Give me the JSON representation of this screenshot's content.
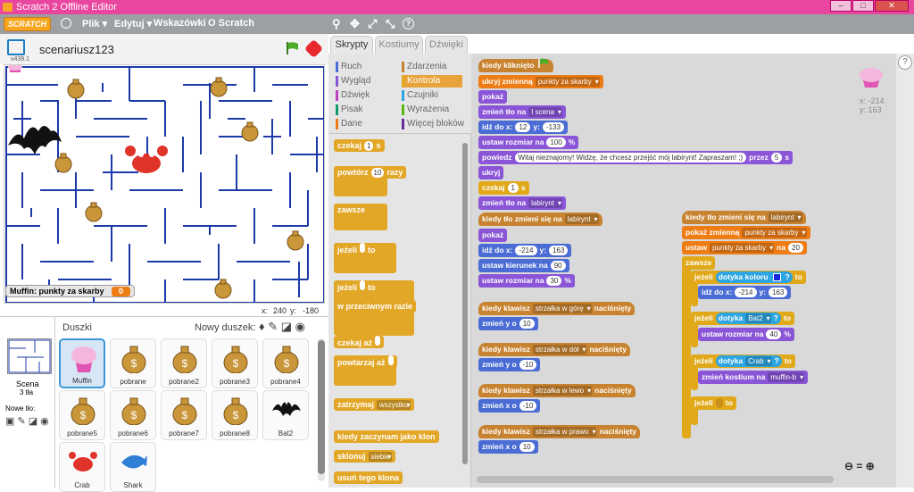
{
  "window": {
    "title": "Scratch 2 Offline Editor"
  },
  "menu": {
    "logo": "SCRATCH",
    "items": [
      "Plik ▾",
      "Edytuj ▾",
      "Wskazówki",
      "O Scratch"
    ]
  },
  "stage": {
    "project_name": "scenariusz123",
    "version": "v439.1",
    "monitor_label": "Muffin: punkty za skarby",
    "monitor_value": "0",
    "x_label": "x:",
    "x_value": "240",
    "y_label": "y:",
    "y_value": "-180"
  },
  "sprites_panel": {
    "title": "Duszki",
    "new_sprite": "Nowy duszek:",
    "scene_label": "Scena",
    "scene_count": "3 tła",
    "new_backdrop": "Nowe tło:",
    "sprites": [
      "Muffin",
      "pobrane",
      "pobrane2",
      "pobrane3",
      "pobrane4",
      "pobrane5",
      "pobrane6",
      "pobrane7",
      "pobrane8",
      "Bat2",
      "Crab",
      "Shark"
    ]
  },
  "tabs": [
    "Skrypty",
    "Kostiumy",
    "Dźwięki"
  ],
  "categories": [
    {
      "name": "Ruch",
      "color": "#4a6cd4"
    },
    {
      "name": "Zdarzenia",
      "color": "#c88330"
    },
    {
      "name": "Wygląd",
      "color": "#8a55d7"
    },
    {
      "name": "Kontrola",
      "color": "#e1a91a"
    },
    {
      "name": "Dźwięk",
      "color": "#bb42c3"
    },
    {
      "name": "Czujniki",
      "color": "#2ca5e2"
    },
    {
      "name": "Pisak",
      "color": "#0e9a6c"
    },
    {
      "name": "Wyrażenia",
      "color": "#5cb712"
    },
    {
      "name": "Dane",
      "color": "#ee7d16"
    },
    {
      "name": "Więcej bloków",
      "color": "#632d99"
    }
  ],
  "palette_blocks": [
    "czekaj",
    "s",
    "powtórz",
    "razy",
    "zawsze",
    "jeżeli",
    "to",
    "jeżeli",
    "to",
    "w przeciwnym razie",
    "czekaj aż",
    "powtarzaj aż",
    "zatrzymaj",
    "wszystko",
    "kiedy zaczynam jako klon",
    "sklonuj",
    "siebie",
    "usuń tego klona"
  ],
  "script_coords": {
    "x_label": "x:",
    "x": "-214",
    "y_label": "y:",
    "y": "163"
  },
  "scripts": {
    "main": [
      {
        "t": "kiedy kliknięto",
        "c": "ev",
        "hat": true
      },
      {
        "t": "ukryj zmienną",
        "dd": "punkty za skarby",
        "c": "data"
      },
      {
        "t": "pokaż",
        "c": "looks"
      },
      {
        "t": "zmień tło na",
        "dd": "I scena",
        "c": "looks"
      },
      {
        "t": "idź do x:",
        "i1": "12",
        "t2": "y:",
        "i2": "-133",
        "c": "motion"
      },
      {
        "t": "ustaw rozmiar na",
        "i1": "100",
        "t2": "%",
        "c": "looks"
      },
      {
        "t": "powiedz",
        "i1": "Witaj nieznajomy! Widzę, że chcesz przejść mój labirynt! Zapraszam! ;)",
        "t2": "przez",
        "i2": "5",
        "t3": "s",
        "c": "looks"
      },
      {
        "t": "ukryj",
        "c": "looks"
      },
      {
        "t": "czekaj",
        "i1": "1",
        "t2": "s",
        "c": "ctl"
      },
      {
        "t": "zmień tło na",
        "dd": "labirynt",
        "c": "looks"
      }
    ],
    "bg1": [
      {
        "t": "kiedy tło zmieni się na",
        "dd": "labirynt",
        "c": "ev",
        "hat": true
      },
      {
        "t": "pokaż",
        "c": "looks"
      },
      {
        "t": "idź do x:",
        "i1": "-214",
        "t2": "y:",
        "i2": "163",
        "c": "motion"
      },
      {
        "t": "ustaw kierunek na",
        "i1": "90",
        "c": "motion"
      },
      {
        "t": "ustaw rozmiar na",
        "i1": "30",
        "t2": "%",
        "c": "looks"
      }
    ],
    "keys": [
      {
        "key": "strzałka w górę",
        "action": "zmień y o",
        "val": "10"
      },
      {
        "key": "strzałka w dół",
        "action": "zmień y o",
        "val": "-10"
      },
      {
        "key": "strzałka w lewo",
        "action": "zmień x o",
        "val": "-10"
      },
      {
        "key": "strzałka w prawo",
        "action": "zmień x o",
        "val": "10"
      }
    ],
    "key_hat_a": "kiedy klawisz",
    "key_hat_b": "naciśnięty",
    "bg2": {
      "hat": "kiedy tło zmieni się na",
      "hat_dd": "labirynt",
      "show_var": "pokaż zmienną",
      "show_var_dd": "punkty za skarby",
      "set_var": "ustaw",
      "set_var_dd": "punkty za skarby",
      "set_to": "na",
      "set_val": "20",
      "forever": "zawsze",
      "if": "jeżeli",
      "then": "to",
      "touch_color": "dotyka koloru",
      "q": "?",
      "goto": "idź do x:",
      "goto_x": "-214",
      "goto_y_label": "y:",
      "goto_y": "163",
      "touching": "dotyka",
      "bat": "Bat2",
      "crab": "Crab",
      "set_size": "ustaw rozmiar na",
      "set_size_val": "40",
      "pct": "%",
      "costume": "zmień kostium na",
      "costume_dd": "muffin-b"
    }
  }
}
